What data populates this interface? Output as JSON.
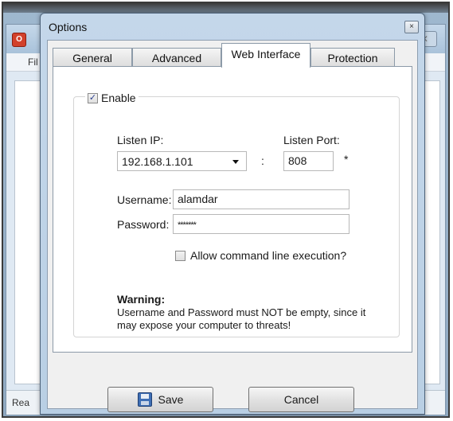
{
  "background_window": {
    "menu_file": "Fil",
    "status_text": "Rea"
  },
  "dialog": {
    "title": "Options",
    "close_glyph": "×"
  },
  "tabs": [
    {
      "label": "General",
      "active": false
    },
    {
      "label": "Advanced",
      "active": false
    },
    {
      "label": "Web Interface",
      "active": true
    },
    {
      "label": "Protection",
      "active": false
    }
  ],
  "web_interface": {
    "enable_label": "Enable",
    "enable_checked": true,
    "listen_ip_label": "Listen IP:",
    "listen_ip_value": "192.168.1.101",
    "colon": ":",
    "listen_port_label": "Listen Port:",
    "listen_port_value": "808",
    "required_marker": "*",
    "username_label": "Username:",
    "username_value": "alamdar",
    "password_label": "Password:",
    "password_value": "*******",
    "allow_cmd_label": "Allow command line execution?",
    "allow_cmd_checked": false,
    "warning_title": "Warning:",
    "warning_text": "Username and Password must NOT be empty, since it may expose your computer to threats!"
  },
  "buttons": {
    "save_label": "Save",
    "cancel_label": "Cancel"
  },
  "icons": {
    "save_icon": "floppy-disk",
    "check_mark": "✓"
  },
  "colors": {
    "dialog_frame": "#b9cfe4",
    "tab_active_bg": "#ffffff",
    "checkbox_mark": "#2b3f8f"
  }
}
